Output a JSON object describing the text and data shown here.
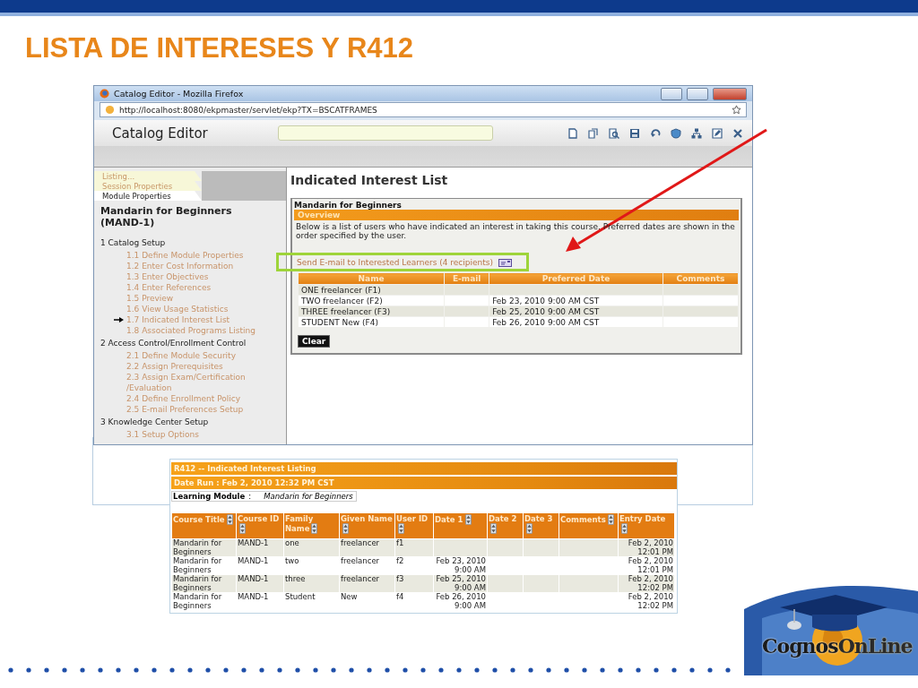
{
  "slide_title": "LISTA DE INTERESES Y R412",
  "browser": {
    "title": "Catalog Editor - Mozilla Firefox",
    "url": "http://localhost:8080/ekpmaster/servlet/ekp?TX=BSCATFRAMES"
  },
  "app": {
    "title": "Catalog Editor"
  },
  "sidebar": {
    "tabs": [
      {
        "label": "Listing...",
        "selected": false
      },
      {
        "label": "Session Properties",
        "selected": false
      },
      {
        "label": "Module Properties",
        "selected": true
      }
    ],
    "module_title": "Mandarin for Beginners (MAND-1)",
    "sections": [
      {
        "label": "1 Catalog Setup",
        "children": [
          {
            "label": "1.1 Define Module Properties",
            "selected": false
          },
          {
            "label": "1.2 Enter Cost Information",
            "selected": false
          },
          {
            "label": "1.3 Enter Objectives",
            "selected": false
          },
          {
            "label": "1.4 Enter References",
            "selected": false
          },
          {
            "label": "1.5 Preview",
            "selected": false
          },
          {
            "label": "1.6 View Usage Statistics",
            "selected": false
          },
          {
            "label": "1.7 Indicated Interest List",
            "selected": true
          },
          {
            "label": "1.8 Associated Programs Listing",
            "selected": false
          }
        ]
      },
      {
        "label": "2 Access Control/Enrollment Control",
        "children": [
          {
            "label": "2.1 Define Module Security",
            "selected": false
          },
          {
            "label": "2.2 Assign Prerequisites",
            "selected": false
          },
          {
            "label": "2.3 Assign Exam/Certification /Evaluation",
            "selected": false
          },
          {
            "label": "2.4 Define Enrollment Policy",
            "selected": false
          },
          {
            "label": "2.5 E-mail Preferences Setup",
            "selected": false
          }
        ]
      },
      {
        "label": "3 Knowledge Center Setup",
        "children": [
          {
            "label": "3.1 Setup Options",
            "selected": false
          }
        ]
      }
    ]
  },
  "main": {
    "heading": "Indicated Interest List",
    "panel_title": "Mandarin for Beginners",
    "overview_label": "Overview",
    "description": "Below is a list of users who have indicated an interest in taking this course. Preferred dates are shown in the order specified by the user.",
    "email_link": "Send E-mail to Interested Learners (4 recipients)",
    "table": {
      "columns": [
        "Name",
        "E-mail",
        "Preferred Date",
        "Comments"
      ],
      "rows": [
        [
          "ONE freelancer (F1)",
          "",
          "",
          ""
        ],
        [
          "TWO freelancer (F2)",
          "",
          "Feb 23, 2010 9:00 AM CST",
          ""
        ],
        [
          "THREE freelancer (F3)",
          "",
          "Feb 25, 2010 9:00 AM CST",
          ""
        ],
        [
          "STUDENT New (F4)",
          "",
          "Feb 26, 2010 9:00 AM CST",
          ""
        ]
      ]
    },
    "clear_button": "Clear"
  },
  "report": {
    "title": "R412 -- Indicated Interest Listing",
    "date_run": "Date Run : Feb 2, 2010 12:32 PM CST",
    "module_label": "Learning Module",
    "module_separator": ":",
    "module_value": "Mandarin for Beginners",
    "table": {
      "columns": [
        "Course Title",
        "Course ID",
        "Family Name",
        "Given Name",
        "User ID",
        "Date 1",
        "Date 2",
        "Date 3",
        "Comments",
        "Entry Date"
      ],
      "rows": [
        [
          "Mandarin for Beginners",
          "MAND-1",
          "one",
          "freelancer",
          "f1",
          "",
          "",
          "",
          "",
          "Feb 2, 2010 12:01 PM"
        ],
        [
          "Mandarin for Beginners",
          "MAND-1",
          "two",
          "freelancer",
          "f2",
          "Feb 23, 2010 9:00 AM",
          "",
          "",
          "",
          "Feb 2, 2010 12:01 PM"
        ],
        [
          "Mandarin for Beginners",
          "MAND-1",
          "three",
          "freelancer",
          "f3",
          "Feb 25, 2010 9:00 AM",
          "",
          "",
          "",
          "Feb 2, 2010 12:02 PM"
        ],
        [
          "Mandarin for Beginners",
          "MAND-1",
          "Student",
          "New",
          "f4",
          "Feb 26, 2010 9:00 AM",
          "",
          "",
          "",
          "Feb 2, 2010 12:02 PM"
        ]
      ]
    }
  },
  "logo": {
    "first": "Cognos",
    "second": "OnLine"
  }
}
